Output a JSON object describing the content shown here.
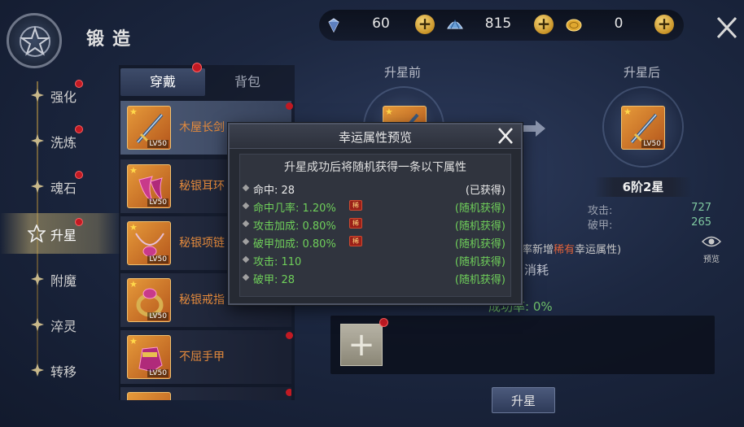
{
  "header": {
    "title": "锻造"
  },
  "currencies": [
    {
      "icon": "diamond-icon",
      "value": "60"
    },
    {
      "icon": "fan-gem-icon",
      "value": "815"
    },
    {
      "icon": "gold-coin-icon",
      "value": "0"
    }
  ],
  "nav": {
    "items": [
      {
        "label": "强化",
        "badge": true
      },
      {
        "label": "洗炼",
        "badge": true
      },
      {
        "label": "魂石",
        "badge": true
      },
      {
        "label": "升星",
        "badge": true,
        "active": true
      },
      {
        "label": "附魔",
        "badge": false
      },
      {
        "label": "淬灵",
        "badge": false
      },
      {
        "label": "转移",
        "badge": false
      }
    ]
  },
  "tabs": {
    "equipped": "穿戴",
    "bag": "背包"
  },
  "items": [
    {
      "name": "木屋长剑",
      "level": "LV50"
    },
    {
      "name": "秘银耳环",
      "level": "LV50"
    },
    {
      "name": "秘银项链",
      "level": "LV50"
    },
    {
      "name": "秘银戒指",
      "level": "LV50"
    },
    {
      "name": "不屈手甲",
      "level": "LV50"
    }
  ],
  "upgrade": {
    "before_label": "升星前",
    "after_label": "升星后",
    "after_level": "LV50",
    "star_level": "6阶2星",
    "stats": [
      {
        "name": "攻击:",
        "value": "727"
      },
      {
        "name": "破甲:",
        "value": "265"
      }
    ],
    "note_prefix": "概率新增",
    "note_rare": "稀有",
    "note_suffix": "幸运属性)",
    "preview_label": "预览",
    "consume_title": "消耗",
    "success_rate": "成功率: 0%",
    "button_label": "升星"
  },
  "modal": {
    "title": "幸运属性预览",
    "description": "升星成功后将随机获得一条以下属性",
    "rare_tag": "稀",
    "attributes": [
      {
        "name": "命中: 28",
        "status": "(已获得)",
        "color": "white",
        "rare": false
      },
      {
        "name": "命中几率: 1.20%",
        "status": "(随机获得)",
        "color": "green",
        "rare": true
      },
      {
        "name": "攻击加成: 0.80%",
        "status": "(随机获得)",
        "color": "green",
        "rare": true
      },
      {
        "name": "破甲加成: 0.80%",
        "status": "(随机获得)",
        "color": "green",
        "rare": true
      },
      {
        "name": "攻击: 110",
        "status": "(随机获得)",
        "color": "green",
        "rare": false
      },
      {
        "name": "破甲: 28",
        "status": "(随机获得)",
        "color": "green",
        "rare": false
      }
    ]
  },
  "colors": {
    "accent_gold": "#c89327",
    "rare_red": "#e0623a",
    "random_green": "#6fcf5a",
    "badge_red": "#c21a23"
  }
}
